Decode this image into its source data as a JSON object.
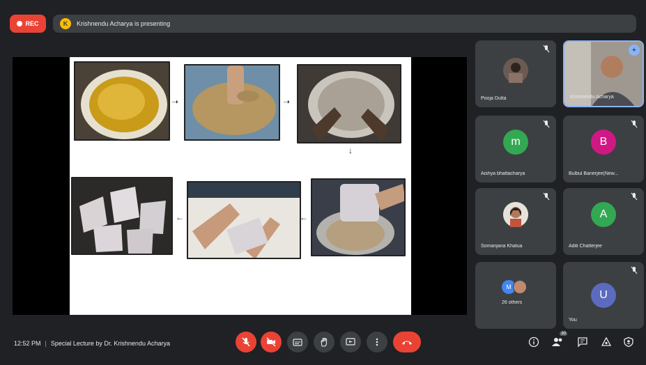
{
  "topbar": {
    "rec_label": "REC",
    "presenting_text": "Krishnendu Acharya is presenting"
  },
  "participants": [
    {
      "name": "Pooja Dutta",
      "avatar_type": "photo"
    },
    {
      "name": "Krishnendu Acharya",
      "avatar_type": "video"
    },
    {
      "name": "Aishya bhattacharya",
      "initial": "m",
      "color": "#33a852"
    },
    {
      "name": "Bulbul Banerjee(New...",
      "initial": "B",
      "color": "#d01884"
    },
    {
      "name": "Somanjana Khatua",
      "avatar_type": "photo"
    },
    {
      "name": "Aditi Chatterjee",
      "initial": "A",
      "color": "#33a852"
    },
    {
      "name": "26 others",
      "avatar_type": "group"
    },
    {
      "name": "You",
      "initial": "U",
      "color": "#5c6bc0"
    }
  ],
  "bottombar": {
    "time": "12:52 PM",
    "separator": "|",
    "meeting_title": "Special Lecture by Dr. Krishnendu Acharya",
    "people_badge": "30"
  },
  "colors": {
    "accent_red": "#ea4335",
    "control_grey": "#3c4043",
    "background": "#202124"
  }
}
